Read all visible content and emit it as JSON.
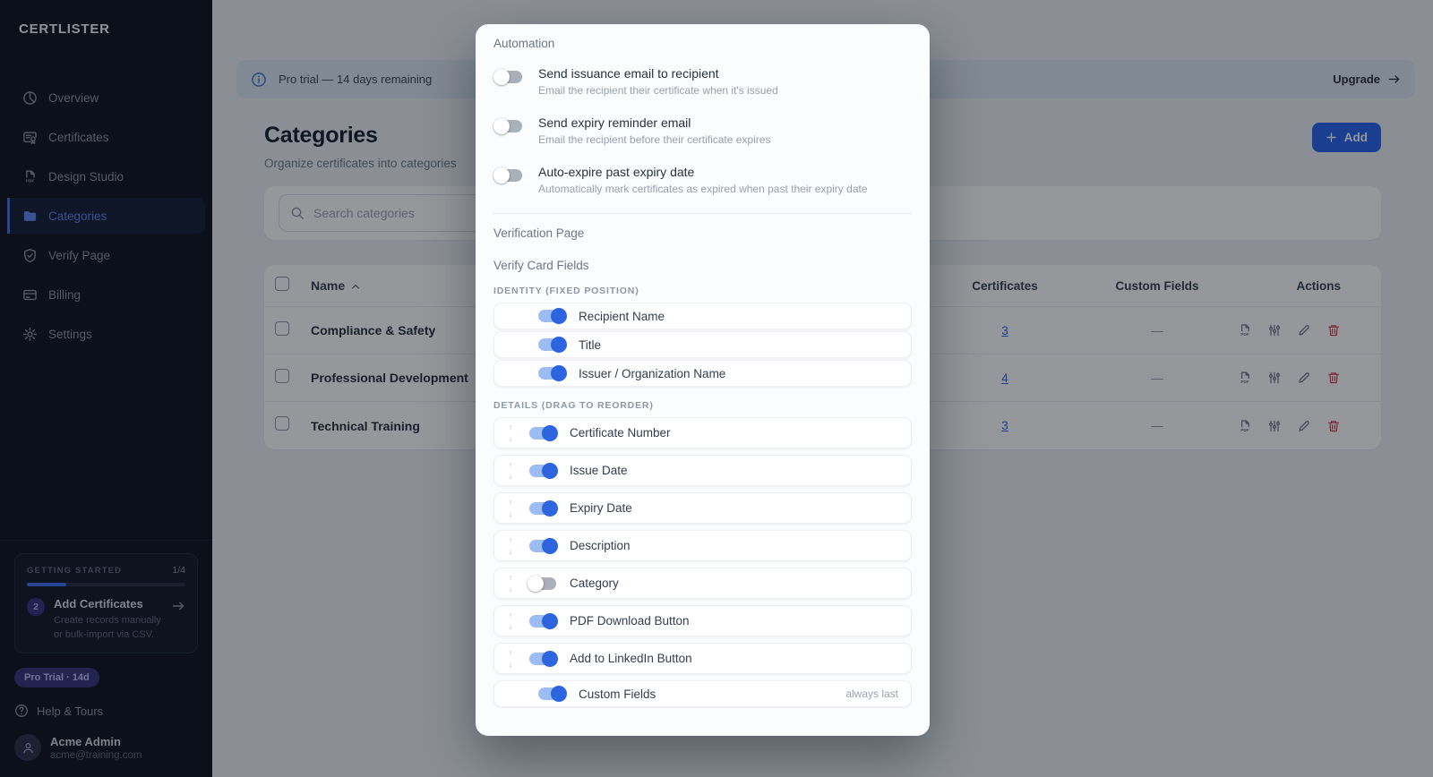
{
  "brand": {
    "name": "CERTLISTER"
  },
  "sidebar": {
    "items": [
      {
        "label": "Overview",
        "icon": "pie-chart-icon",
        "active": false
      },
      {
        "label": "Certificates",
        "icon": "certificate-icon",
        "active": false
      },
      {
        "label": "Design Studio",
        "icon": "pdf-file-icon",
        "active": false
      },
      {
        "label": "Categories",
        "icon": "folder-icon",
        "active": true
      },
      {
        "label": "Verify Page",
        "icon": "shield-check-icon",
        "active": false
      },
      {
        "label": "Billing",
        "icon": "credit-card-icon",
        "active": false
      },
      {
        "label": "Settings",
        "icon": "gear-icon",
        "active": false
      }
    ],
    "getting_started": {
      "title": "GETTING STARTED",
      "progress_label": "1/4",
      "progress_pct": 25,
      "step_number": "2",
      "step_title": "Add Certificates",
      "step_desc": "Create records manually or bulk-import via CSV."
    },
    "trial_badge": "Pro Trial · 14d",
    "help_label": "Help & Tours",
    "user": {
      "name": "Acme Admin",
      "email": "acme@training.com"
    }
  },
  "banner": {
    "text": "Pro trial — 14 days remaining",
    "upgrade_label": "Upgrade"
  },
  "page": {
    "title": "Categories",
    "subtitle": "Organize certificates into categories",
    "add_label": "Add"
  },
  "search": {
    "placeholder": "Search categories"
  },
  "table": {
    "headers": {
      "name": "Name",
      "certificates": "Certificates",
      "custom_fields": "Custom Fields",
      "actions": "Actions"
    },
    "rows": [
      {
        "name": "Compliance & Safety",
        "certificates": "3",
        "custom_fields": "—"
      },
      {
        "name": "Professional Development",
        "certificates": "4",
        "custom_fields": "—"
      },
      {
        "name": "Technical Training",
        "certificates": "3",
        "custom_fields": "—"
      }
    ]
  },
  "modal": {
    "automation": {
      "title": "Automation",
      "toggles": [
        {
          "title": "Send issuance email to recipient",
          "desc": "Email the recipient their certificate when it's issued",
          "on": false
        },
        {
          "title": "Send expiry reminder email",
          "desc": "Email the recipient before their certificate expires",
          "on": false
        },
        {
          "title": "Auto-expire past expiry date",
          "desc": "Automatically mark certificates as expired when past their expiry date",
          "on": false
        }
      ]
    },
    "verification_title": "Verification Page",
    "verify_card_fields": {
      "title": "Verify Card Fields",
      "identity_header": "IDENTITY (FIXED POSITION)",
      "identity_rows": [
        {
          "label": "Recipient Name",
          "on": true
        },
        {
          "label": "Title",
          "on": true
        },
        {
          "label": "Issuer / Organization Name",
          "on": true
        }
      ],
      "details_header": "DETAILS (DRAG TO REORDER)",
      "details_rows": [
        {
          "label": "Certificate Number",
          "on": true
        },
        {
          "label": "Issue Date",
          "on": true
        },
        {
          "label": "Expiry Date",
          "on": true
        },
        {
          "label": "Description",
          "on": true
        },
        {
          "label": "Category",
          "on": false
        },
        {
          "label": "PDF Download Button",
          "on": true
        },
        {
          "label": "Add to LinkedIn Button",
          "on": true
        }
      ],
      "custom_fields_row": {
        "label": "Custom Fields",
        "on": true,
        "note": "always last"
      }
    }
  },
  "colors": {
    "accent": "#2563eb",
    "danger": "#dc2626",
    "sidebar_bg": "#0a0f1a",
    "banner_bg": "#dbe7f3"
  }
}
